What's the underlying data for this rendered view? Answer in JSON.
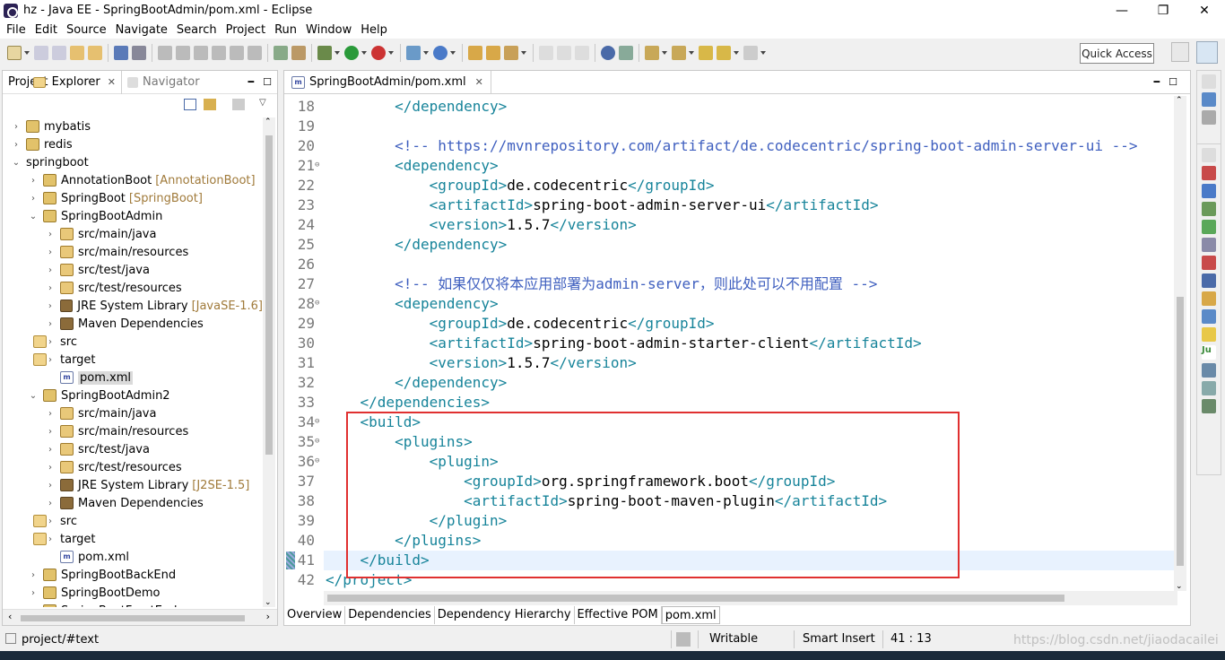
{
  "window": {
    "title": "hz - Java EE - SpringBootAdmin/pom.xml - Eclipse"
  },
  "menu": [
    "File",
    "Edit",
    "Source",
    "Navigate",
    "Search",
    "Project",
    "Run",
    "Window",
    "Help"
  ],
  "toolbar": {
    "quick_access": "Quick Access"
  },
  "left_panel": {
    "tabs": [
      {
        "label": "Project Explorer",
        "active": true
      },
      {
        "label": "Navigator",
        "active": false
      }
    ],
    "tree": [
      {
        "label": "mybatis",
        "indent": 0,
        "twisty": "›",
        "icon": "proj",
        "deco": ""
      },
      {
        "label": "redis",
        "indent": 0,
        "twisty": "›",
        "icon": "proj",
        "deco": ""
      },
      {
        "label": "springboot",
        "indent": 0,
        "twisty": "⌄",
        "icon": "none",
        "deco": ""
      },
      {
        "label": "AnnotationBoot",
        "indent": 1,
        "twisty": "›",
        "icon": "proj",
        "deco": "[AnnotationBoot]"
      },
      {
        "label": "SpringBoot",
        "indent": 1,
        "twisty": "›",
        "icon": "proj",
        "deco": "[SpringBoot]"
      },
      {
        "label": "SpringBootAdmin",
        "indent": 1,
        "twisty": "⌄",
        "icon": "proj",
        "deco": ""
      },
      {
        "label": "src/main/java",
        "indent": 2,
        "twisty": "›",
        "icon": "pkg",
        "deco": ""
      },
      {
        "label": "src/main/resources",
        "indent": 2,
        "twisty": "›",
        "icon": "pkg",
        "deco": ""
      },
      {
        "label": "src/test/java",
        "indent": 2,
        "twisty": "›",
        "icon": "pkg",
        "deco": ""
      },
      {
        "label": "src/test/resources",
        "indent": 2,
        "twisty": "›",
        "icon": "pkg",
        "deco": ""
      },
      {
        "label": "JRE System Library",
        "indent": 2,
        "twisty": "›",
        "icon": "lib",
        "deco": "[JavaSE-1.6]"
      },
      {
        "label": "Maven Dependencies",
        "indent": 2,
        "twisty": "›",
        "icon": "lib",
        "deco": ""
      },
      {
        "label": "src",
        "indent": 2,
        "twisty": "›",
        "icon": "fold",
        "deco": ""
      },
      {
        "label": "target",
        "indent": 2,
        "twisty": "›",
        "icon": "fold",
        "deco": ""
      },
      {
        "label": "pom.xml",
        "indent": 2,
        "twisty": "",
        "icon": "pom",
        "deco": "",
        "selected": true
      },
      {
        "label": "SpringBootAdmin2",
        "indent": 1,
        "twisty": "⌄",
        "icon": "proj",
        "deco": ""
      },
      {
        "label": "src/main/java",
        "indent": 2,
        "twisty": "›",
        "icon": "pkg",
        "deco": ""
      },
      {
        "label": "src/main/resources",
        "indent": 2,
        "twisty": "›",
        "icon": "pkg",
        "deco": ""
      },
      {
        "label": "src/test/java",
        "indent": 2,
        "twisty": "›",
        "icon": "pkg",
        "deco": ""
      },
      {
        "label": "src/test/resources",
        "indent": 2,
        "twisty": "›",
        "icon": "pkg",
        "deco": ""
      },
      {
        "label": "JRE System Library",
        "indent": 2,
        "twisty": "›",
        "icon": "lib",
        "deco": "[J2SE-1.5]"
      },
      {
        "label": "Maven Dependencies",
        "indent": 2,
        "twisty": "›",
        "icon": "lib",
        "deco": ""
      },
      {
        "label": "src",
        "indent": 2,
        "twisty": "›",
        "icon": "fold",
        "deco": ""
      },
      {
        "label": "target",
        "indent": 2,
        "twisty": "›",
        "icon": "fold",
        "deco": ""
      },
      {
        "label": "pom.xml",
        "indent": 2,
        "twisty": "",
        "icon": "pom",
        "deco": ""
      },
      {
        "label": "SpringBootBackEnd",
        "indent": 1,
        "twisty": "›",
        "icon": "proj",
        "deco": ""
      },
      {
        "label": "SpringBootDemo",
        "indent": 1,
        "twisty": "›",
        "icon": "proj",
        "deco": ""
      },
      {
        "label": "SpringBootFrontEnd",
        "indent": 1,
        "twisty": "›",
        "icon": "proj",
        "deco": ""
      }
    ]
  },
  "editor": {
    "tab": "SpringBootAdmin/pom.xml",
    "current_line": 41,
    "lines": [
      {
        "n": "18",
        "fold": "",
        "indent": "        ",
        "parts": [
          [
            "tag",
            "</dependency>"
          ]
        ]
      },
      {
        "n": "19",
        "fold": "",
        "indent": "",
        "parts": []
      },
      {
        "n": "20",
        "fold": "",
        "indent": "        ",
        "parts": [
          [
            "cmt",
            "<!-- https://mvnrepository.com/artifact/de.codecentric/spring-boot-admin-server-ui -->"
          ]
        ]
      },
      {
        "n": "21",
        "fold": "⊖",
        "indent": "        ",
        "parts": [
          [
            "tag",
            "<dependency>"
          ]
        ]
      },
      {
        "n": "22",
        "fold": "",
        "indent": "            ",
        "parts": [
          [
            "tag",
            "<groupId>"
          ],
          [
            "txt",
            "de.codecentric"
          ],
          [
            "tag",
            "</groupId>"
          ]
        ]
      },
      {
        "n": "23",
        "fold": "",
        "indent": "            ",
        "parts": [
          [
            "tag",
            "<artifactId>"
          ],
          [
            "txt",
            "spring-boot-admin-server-ui"
          ],
          [
            "tag",
            "</artifactId>"
          ]
        ]
      },
      {
        "n": "24",
        "fold": "",
        "indent": "            ",
        "parts": [
          [
            "tag",
            "<version>"
          ],
          [
            "txt",
            "1.5.7"
          ],
          [
            "tag",
            "</version>"
          ]
        ]
      },
      {
        "n": "25",
        "fold": "",
        "indent": "        ",
        "parts": [
          [
            "tag",
            "</dependency>"
          ]
        ]
      },
      {
        "n": "26",
        "fold": "",
        "indent": "",
        "parts": []
      },
      {
        "n": "27",
        "fold": "",
        "indent": "        ",
        "parts": [
          [
            "cmt",
            "<!-- 如果仅仅将本应用部署为admin-server，则此处可以不用配置 -->"
          ]
        ]
      },
      {
        "n": "28",
        "fold": "⊖",
        "indent": "        ",
        "parts": [
          [
            "tag",
            "<dependency>"
          ]
        ]
      },
      {
        "n": "29",
        "fold": "",
        "indent": "            ",
        "parts": [
          [
            "tag",
            "<groupId>"
          ],
          [
            "txt",
            "de.codecentric"
          ],
          [
            "tag",
            "</groupId>"
          ]
        ]
      },
      {
        "n": "30",
        "fold": "",
        "indent": "            ",
        "parts": [
          [
            "tag",
            "<artifactId>"
          ],
          [
            "txt",
            "spring-boot-admin-starter-client"
          ],
          [
            "tag",
            "</artifactId>"
          ]
        ]
      },
      {
        "n": "31",
        "fold": "",
        "indent": "            ",
        "parts": [
          [
            "tag",
            "<version>"
          ],
          [
            "txt",
            "1.5.7"
          ],
          [
            "tag",
            "</version>"
          ]
        ]
      },
      {
        "n": "32",
        "fold": "",
        "indent": "        ",
        "parts": [
          [
            "tag",
            "</dependency>"
          ]
        ]
      },
      {
        "n": "33",
        "fold": "",
        "indent": "    ",
        "parts": [
          [
            "tag",
            "</dependencies>"
          ]
        ]
      },
      {
        "n": "34",
        "fold": "⊖",
        "indent": "    ",
        "parts": [
          [
            "tag",
            "<build>"
          ]
        ]
      },
      {
        "n": "35",
        "fold": "⊖",
        "indent": "        ",
        "parts": [
          [
            "tag",
            "<plugins>"
          ]
        ]
      },
      {
        "n": "36",
        "fold": "⊖",
        "indent": "            ",
        "parts": [
          [
            "tag",
            "<plugin>"
          ]
        ]
      },
      {
        "n": "37",
        "fold": "",
        "indent": "                ",
        "parts": [
          [
            "tag",
            "<groupId>"
          ],
          [
            "txt",
            "org.springframework.boot"
          ],
          [
            "tag",
            "</groupId>"
          ]
        ]
      },
      {
        "n": "38",
        "fold": "",
        "indent": "                ",
        "parts": [
          [
            "tag",
            "<artifactId>"
          ],
          [
            "txt",
            "spring-boot-maven-plugin"
          ],
          [
            "tag",
            "</artifactId>"
          ]
        ]
      },
      {
        "n": "39",
        "fold": "",
        "indent": "            ",
        "parts": [
          [
            "tag",
            "</plugin>"
          ]
        ]
      },
      {
        "n": "40",
        "fold": "",
        "indent": "        ",
        "parts": [
          [
            "tag",
            "</plugins>"
          ]
        ]
      },
      {
        "n": "41",
        "fold": "",
        "indent": "    ",
        "parts": [
          [
            "tag",
            "</build>"
          ]
        ]
      },
      {
        "n": "42",
        "fold": "",
        "indent": "",
        "parts": [
          [
            "tag",
            "</project>"
          ]
        ]
      }
    ],
    "bottom_tabs": [
      "Overview",
      "Dependencies",
      "Dependency Hierarchy",
      "Effective POM",
      "pom.xml"
    ],
    "active_bottom_tab": "pom.xml"
  },
  "status": {
    "path": "project/#text",
    "writable": "Writable",
    "insert_mode": "Smart Insert",
    "position": "41 : 13"
  },
  "watermark": "https://blog.csdn.net/jiaodacailei",
  "colors": {
    "tag": "#17849a",
    "comment": "#3f5fbf",
    "highlight_box": "#e03030",
    "current_line": "#e8f2fe"
  }
}
